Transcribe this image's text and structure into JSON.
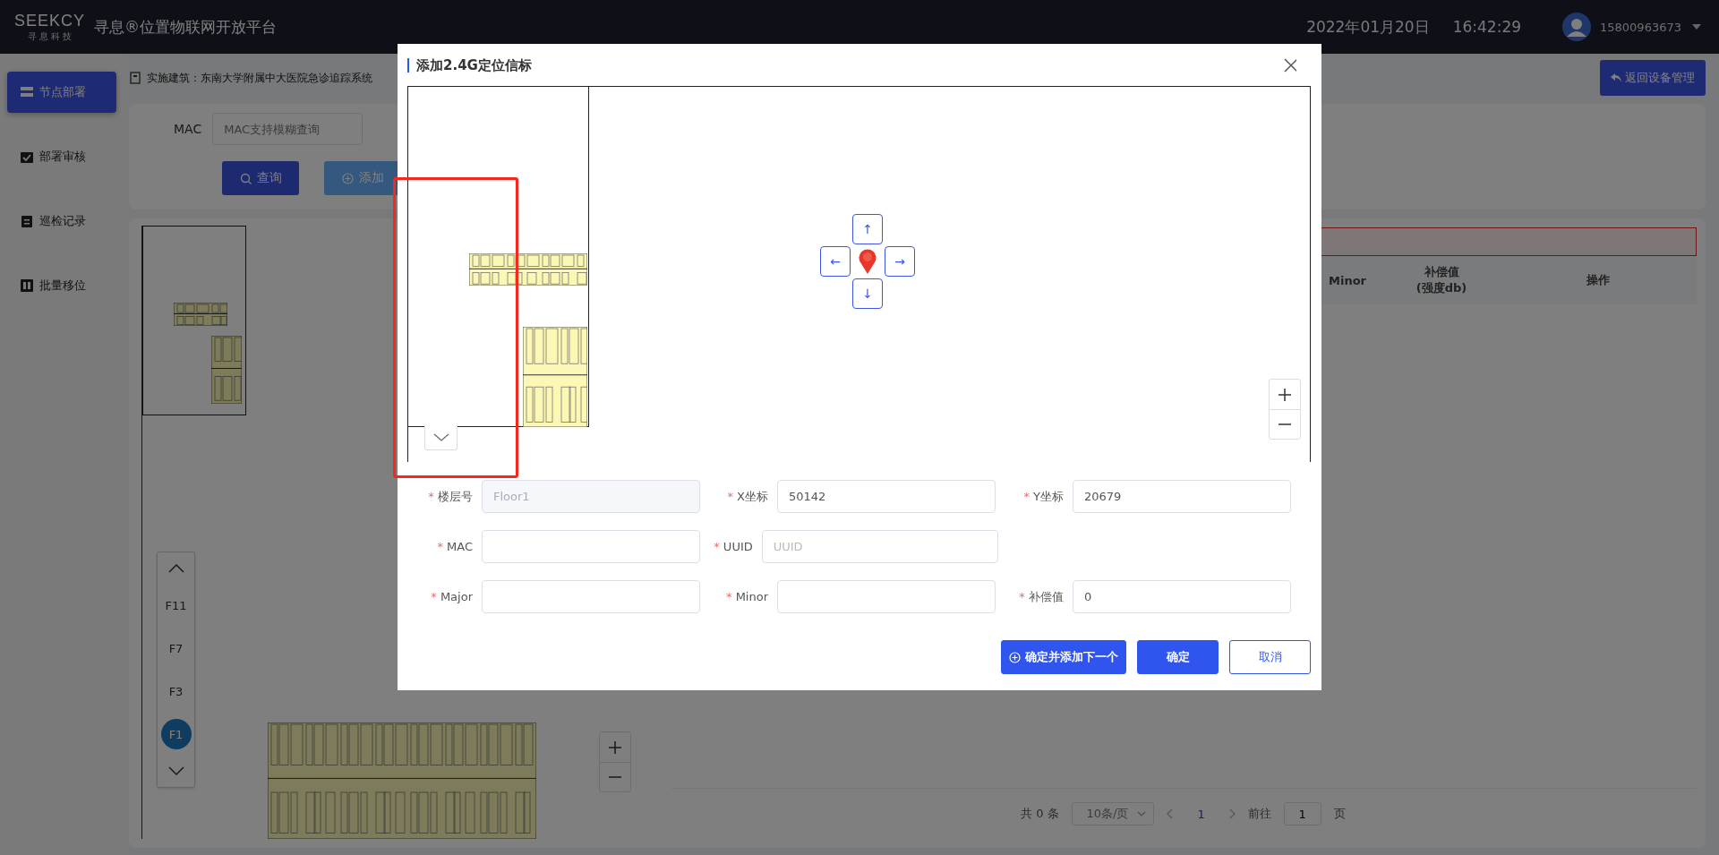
{
  "header": {
    "logo": "SEEKCY",
    "logo_sub": "寻 息 科 技",
    "title": "寻息®位置物联网开放平台",
    "date": "2022年01月20日",
    "time": "16:42:29",
    "user": "15800963673"
  },
  "sidebar": {
    "items": [
      {
        "label": "节点部署",
        "selected": true
      },
      {
        "label": "部署审核",
        "selected": false
      },
      {
        "label": "巡检记录",
        "selected": false
      },
      {
        "label": "批量移位",
        "selected": false
      }
    ]
  },
  "breadcrumb": "实施建筑：东南大学附属中大医院急诊追踪系统",
  "back_button": "返回设备管理",
  "filter": {
    "label": "MAC",
    "placeholder": "MAC支持模糊查询",
    "buttons": [
      {
        "label": "查询",
        "kind": "primary"
      },
      {
        "label": "添加",
        "kind": "light"
      }
    ]
  },
  "floors": [
    {
      "label": "F11",
      "selected": false
    },
    {
      "label": "F7",
      "selected": false
    },
    {
      "label": "F3",
      "selected": false
    },
    {
      "label": "F1",
      "selected": true
    }
  ],
  "table": {
    "columns": [
      "Minor",
      "补偿值\n(强度db)",
      "操作"
    ]
  },
  "pagination": {
    "total": "共 0 条",
    "page_size": "10条/页",
    "pages": [
      {
        "label": "1",
        "selected": true
      }
    ],
    "goto_label": "前往",
    "goto_value": "1",
    "goto_suffix": "页"
  },
  "dialog": {
    "title": "添加2.4G定位信标",
    "nudge_buttons": [
      "↑",
      "←",
      "→",
      "↓"
    ],
    "rows": [
      [
        {
          "marker": "*",
          "label": "楼层号",
          "value": "Floor1",
          "disabled": true
        },
        {
          "marker": "*",
          "label": "X坐标",
          "value": "50142",
          "disabled": false
        },
        {
          "marker": "*",
          "label": "Y坐标",
          "value": "20679",
          "disabled": false
        }
      ],
      [
        {
          "marker": "*",
          "label": "MAC"
        },
        {
          "marker": "*",
          "label": "UUID",
          "placeholder": "UUID"
        }
      ],
      [
        {
          "marker": "*",
          "label": "Major"
        },
        {
          "marker": "*",
          "label": "Minor"
        },
        {
          "marker": "*",
          "label": "补偿值",
          "value": "0",
          "disabled": false
        }
      ]
    ],
    "buttons": [
      {
        "label": "确定并添加下一个",
        "kind": "add"
      },
      {
        "label": "确定",
        "kind": "primary"
      },
      {
        "label": "取消",
        "kind": "outline"
      }
    ]
  }
}
